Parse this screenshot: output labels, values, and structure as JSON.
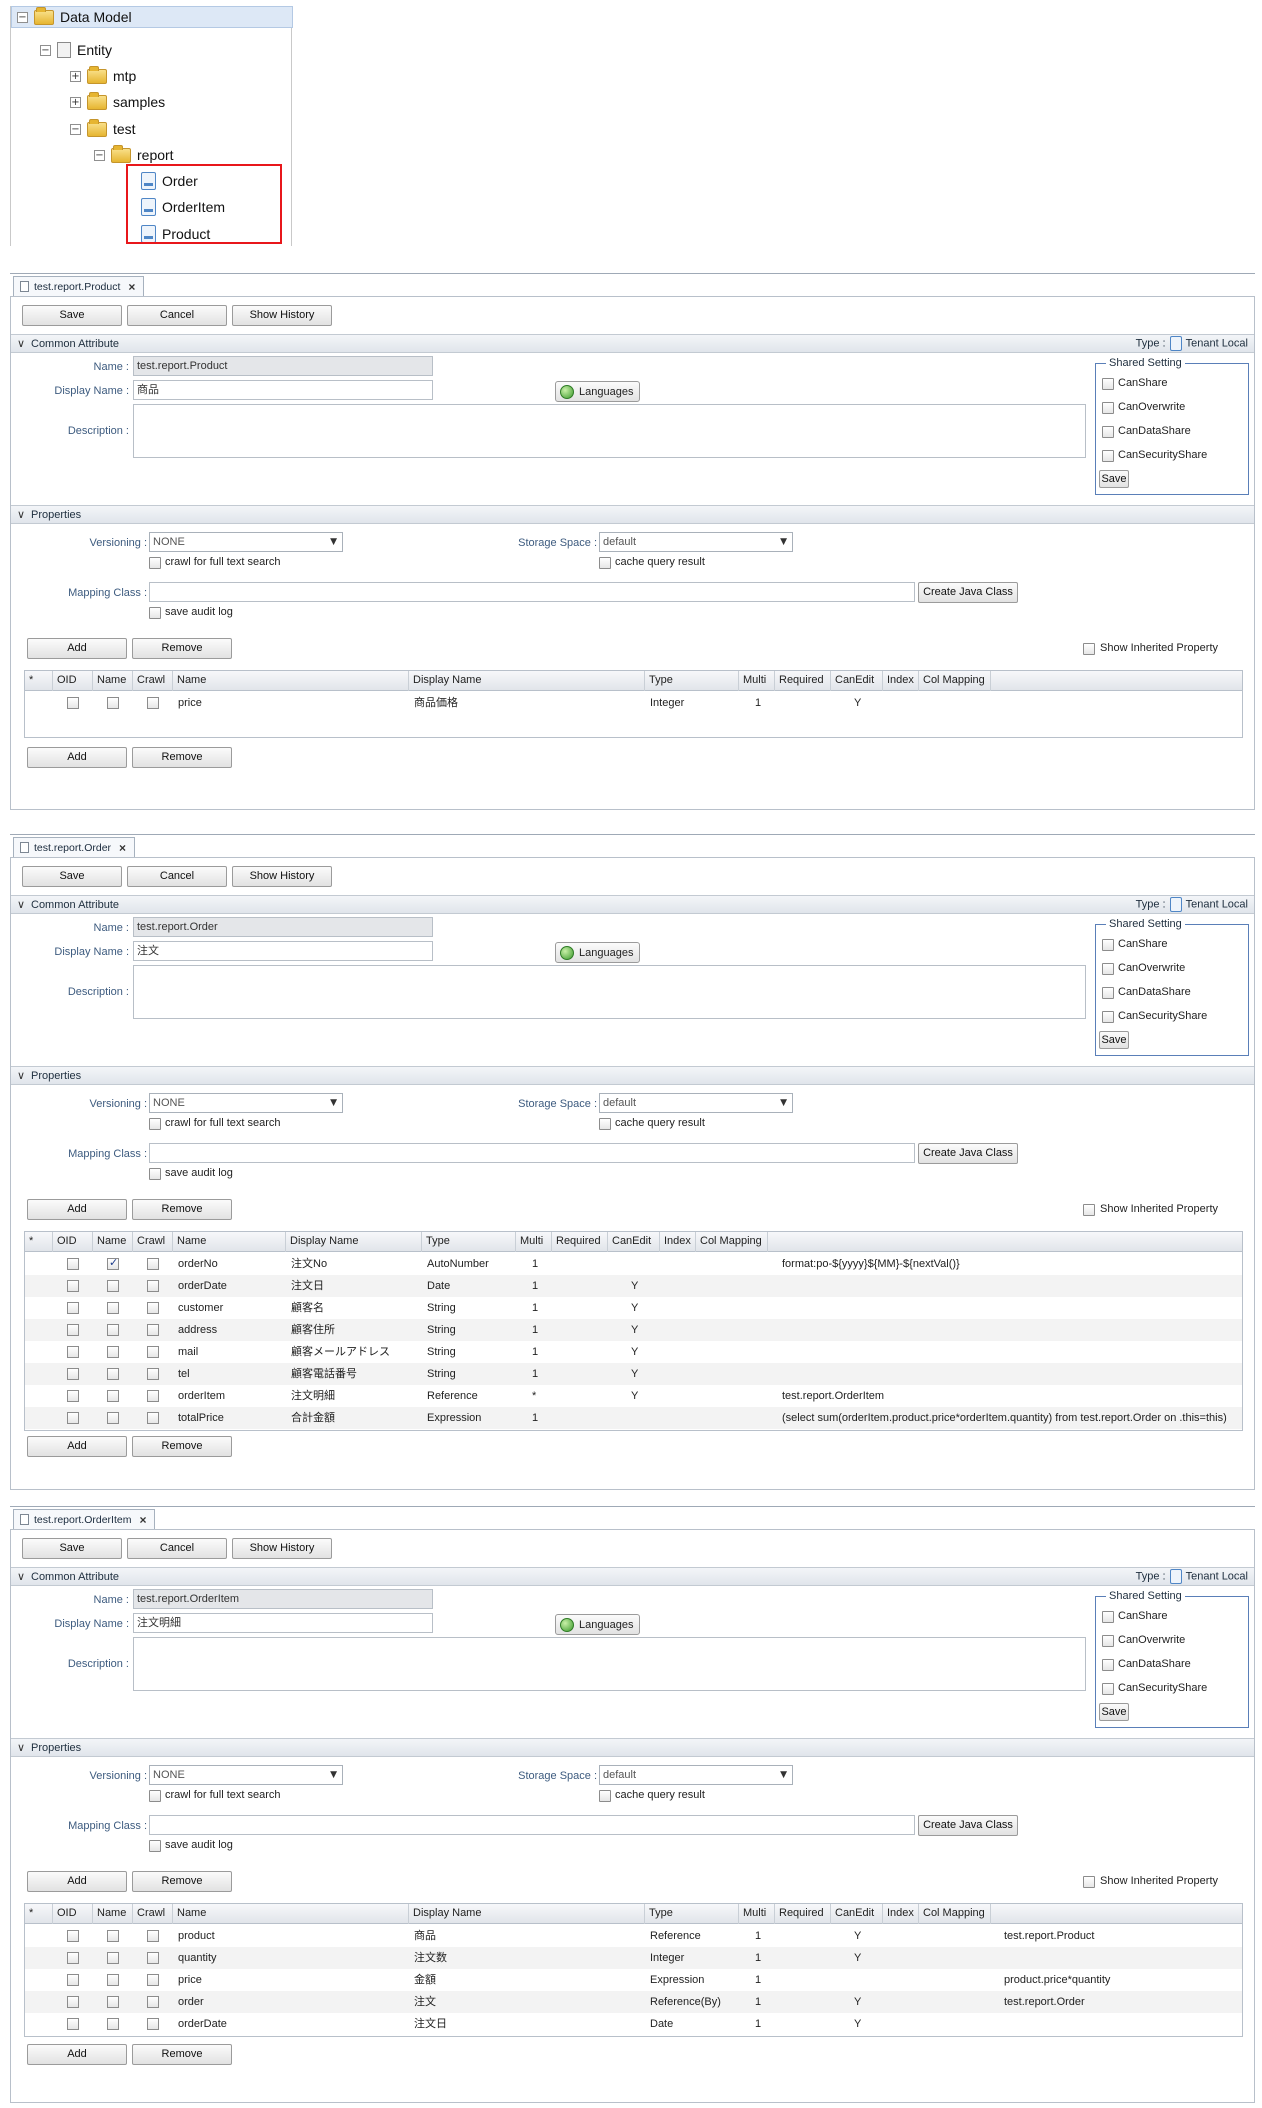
{
  "tree": {
    "root": "Data Model",
    "entity": "Entity",
    "folders": [
      "mtp",
      "samples",
      "test",
      "report"
    ],
    "entities": [
      "Order",
      "OrderItem",
      "Product"
    ]
  },
  "common": {
    "save": "Save",
    "cancel": "Cancel",
    "show_history": "Show History",
    "common_attribute": "Common Attribute",
    "type_label": "Type :",
    "type_value": "Tenant Local",
    "name_label": "Name :",
    "display_name_label": "Display Name :",
    "description_label": "Description :",
    "languages": "Languages",
    "shared_setting": "Shared Setting",
    "shared_options": [
      "CanShare",
      "CanOverwrite",
      "CanDataShare",
      "CanSecurityShare"
    ],
    "shared_save": "Save",
    "properties": "Properties",
    "versioning_label": "Versioning :",
    "versioning_value": "NONE",
    "storage_label": "Storage Space :",
    "storage_value": "default",
    "crawl_full": "crawl for full text search",
    "cache_query": "cache query result",
    "mapping_label": "Mapping Class :",
    "create_java": "Create Java Class",
    "save_audit": "save audit log",
    "add": "Add",
    "remove": "Remove",
    "show_inherited": "Show Inherited Property",
    "columns": [
      "*",
      "OID",
      "Name",
      "Crawl",
      "Name",
      "Display Name",
      "Type",
      "Multi",
      "Required",
      "CanEdit",
      "Index",
      "Col Mapping"
    ]
  },
  "product": {
    "tab": "test.report.Product",
    "name": "test.report.Product",
    "display_name": "商品",
    "rows": [
      {
        "name": "price",
        "display": "商品価格",
        "type": "Integer",
        "multi": "1",
        "canedit": "Y",
        "extra": "",
        "name_checked": false
      }
    ]
  },
  "order": {
    "tab": "test.report.Order",
    "name": "test.report.Order",
    "display_name": "注文",
    "rows": [
      {
        "name": "orderNo",
        "display": "注文No",
        "type": "AutoNumber",
        "multi": "1",
        "canedit": "",
        "extra": "format:po-${yyyy}${MM}-${nextVal()}",
        "name_checked": true
      },
      {
        "name": "orderDate",
        "display": "注文日",
        "type": "Date",
        "multi": "1",
        "canedit": "Y",
        "extra": "",
        "name_checked": false
      },
      {
        "name": "customer",
        "display": "顧客名",
        "type": "String",
        "multi": "1",
        "canedit": "Y",
        "extra": "",
        "name_checked": false
      },
      {
        "name": "address",
        "display": "顧客住所",
        "type": "String",
        "multi": "1",
        "canedit": "Y",
        "extra": "",
        "name_checked": false
      },
      {
        "name": "mail",
        "display": "顧客メールアドレス",
        "type": "String",
        "multi": "1",
        "canedit": "Y",
        "extra": "",
        "name_checked": false
      },
      {
        "name": "tel",
        "display": "顧客電話番号",
        "type": "String",
        "multi": "1",
        "canedit": "Y",
        "extra": "",
        "name_checked": false
      },
      {
        "name": "orderItem",
        "display": "注文明細",
        "type": "Reference",
        "multi": "*",
        "canedit": "Y",
        "extra": "test.report.OrderItem",
        "name_checked": false
      },
      {
        "name": "totalPrice",
        "display": "合計金額",
        "type": "Expression",
        "multi": "1",
        "canedit": "",
        "extra": "(select sum(orderItem.product.price*orderItem.quantity) from test.report.Order on .this=this)",
        "name_checked": false
      }
    ]
  },
  "orderitem": {
    "tab": "test.report.OrderItem",
    "name": "test.report.OrderItem",
    "display_name": "注文明細",
    "rows": [
      {
        "name": "product",
        "display": "商品",
        "type": "Reference",
        "multi": "1",
        "canedit": "Y",
        "extra": "test.report.Product",
        "name_checked": false
      },
      {
        "name": "quantity",
        "display": "注文数",
        "type": "Integer",
        "multi": "1",
        "canedit": "Y",
        "extra": "",
        "name_checked": false
      },
      {
        "name": "price",
        "display": "金額",
        "type": "Expression",
        "multi": "1",
        "canedit": "",
        "extra": "product.price*quantity",
        "name_checked": false
      },
      {
        "name": "order",
        "display": "注文",
        "type": "Reference(By)",
        "multi": "1",
        "canedit": "Y",
        "extra": "test.report.Order",
        "name_checked": false
      },
      {
        "name": "orderDate",
        "display": "注文日",
        "type": "Date",
        "multi": "1",
        "canedit": "Y",
        "extra": "",
        "name_checked": false
      }
    ]
  }
}
